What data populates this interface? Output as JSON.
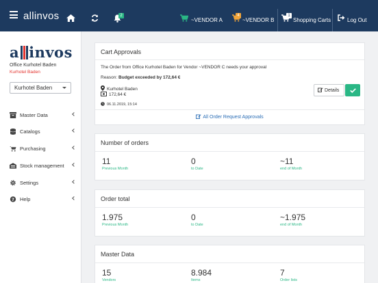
{
  "header": {
    "brand": "allinvos",
    "notifications_badge": "2",
    "vendor_a": {
      "label": "~VENDOR A"
    },
    "vendor_b": {
      "label": "~VENDOR B",
      "badge": "4"
    },
    "carts": {
      "label": "Shopping Carts",
      "badge": "1"
    },
    "logout": "Log Out"
  },
  "sidebar": {
    "logo": {
      "left": "a",
      "right": "invos"
    },
    "office": "Office Kurhotel Baden",
    "sub": "Kurhotel Baden",
    "select_value": "Kurhotel Baden",
    "items": [
      {
        "label": "Master Data",
        "icon": "archive-icon"
      },
      {
        "label": "Catalogs",
        "icon": "database-icon"
      },
      {
        "label": "Purchasing",
        "icon": "cart-icon"
      },
      {
        "label": "Stock management",
        "icon": "warehouse-icon"
      },
      {
        "label": "Settings",
        "icon": "gear-icon"
      },
      {
        "label": "Help",
        "icon": "question-icon"
      }
    ]
  },
  "approvals": {
    "title": "Cart Approvals",
    "message": "The Order from Office Kurhotel Baden for Vendor ~VENDOR C needs your approval",
    "reason_prefix": "Reason: ",
    "reason": "Budget exceeded by 172,64 €",
    "location": "Kurhotel Baden",
    "amount": "172,64 €",
    "date": "06.11.2019, 15:14",
    "details_label": "Details",
    "all_link": "All Order Request Approvals"
  },
  "orders": {
    "title": "Number of orders",
    "stats": [
      {
        "value": "11",
        "label": "Previous Month"
      },
      {
        "value": "0",
        "label": "to Date"
      },
      {
        "value": "~11",
        "label": "end of Month"
      }
    ]
  },
  "total": {
    "title": "Order total",
    "stats": [
      {
        "value": "1.975",
        "label": "Previous Month"
      },
      {
        "value": "0",
        "label": "to Date"
      },
      {
        "value": "~1.975",
        "label": "end of Month"
      }
    ]
  },
  "master": {
    "title": "Master Data",
    "stats": [
      {
        "value": "15",
        "label": "Vendors"
      },
      {
        "value": "8.984",
        "label": "Items"
      },
      {
        "value": "7",
        "label": "Order lists"
      }
    ]
  },
  "colors": {
    "navy": "#1d3a5f",
    "green": "#2ab785",
    "orange": "#f0a43a",
    "red": "#e3342f",
    "link": "#2a6db5"
  }
}
